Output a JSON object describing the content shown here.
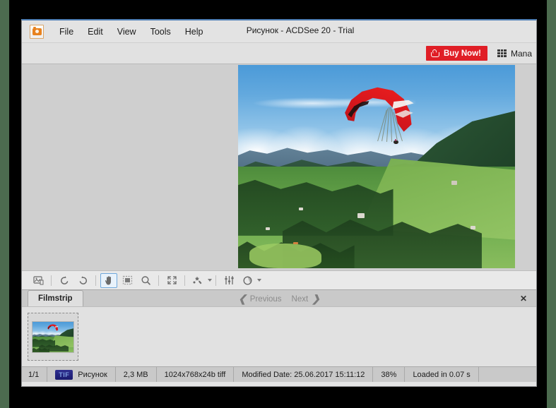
{
  "window": {
    "title": "Рисунок - ACDSee 20 - Trial",
    "app_icon": "camera-icon"
  },
  "menubar": {
    "items": [
      {
        "label": "File"
      },
      {
        "label": "Edit"
      },
      {
        "label": "View"
      },
      {
        "label": "Tools"
      },
      {
        "label": "Help"
      }
    ]
  },
  "topstrip": {
    "buy_label": "Buy Now!",
    "buy_icon": "shopping-cart-icon",
    "buy_color": "#e01e26",
    "manage_label": "Mana",
    "manage_icon": "grid-icon"
  },
  "viewer": {
    "background": "#cfcfcf",
    "image_alt": "paraglider-over-alpine-hills"
  },
  "toolbar": {
    "buttons": [
      {
        "name": "image-properties-icon",
        "title": "Properties"
      },
      {
        "name": "rotate-left-icon",
        "title": "Rotate Left"
      },
      {
        "name": "rotate-right-icon",
        "title": "Rotate Right"
      },
      {
        "name": "pan-hand-icon",
        "title": "Pan",
        "active": true
      },
      {
        "name": "select-region-icon",
        "title": "Select"
      },
      {
        "name": "zoom-icon",
        "title": "Zoom"
      },
      {
        "name": "fit-to-window-icon",
        "title": "Fit to Window"
      },
      {
        "name": "effects-icon",
        "title": "Effects"
      },
      {
        "name": "adjust-sliders-icon",
        "title": "Adjust"
      },
      {
        "name": "exposure-icon",
        "title": "Exposure"
      }
    ]
  },
  "filmstrip": {
    "tab_label": "Filmstrip",
    "previous_label": "Previous",
    "next_label": "Next",
    "close_label": "✕",
    "thumbnails": [
      {
        "name": "thumbnail-paraglider",
        "selected": true
      }
    ]
  },
  "statusbar": {
    "index": "1/1",
    "format_badge": "TIF",
    "filename": "Рисунок",
    "filesize": "2,3 MB",
    "dimensions": "1024x768x24b tiff",
    "modified": "Modified Date: 25.06.2017 15:11:12",
    "zoom": "38%",
    "load_time": "Loaded in 0.07 s"
  }
}
